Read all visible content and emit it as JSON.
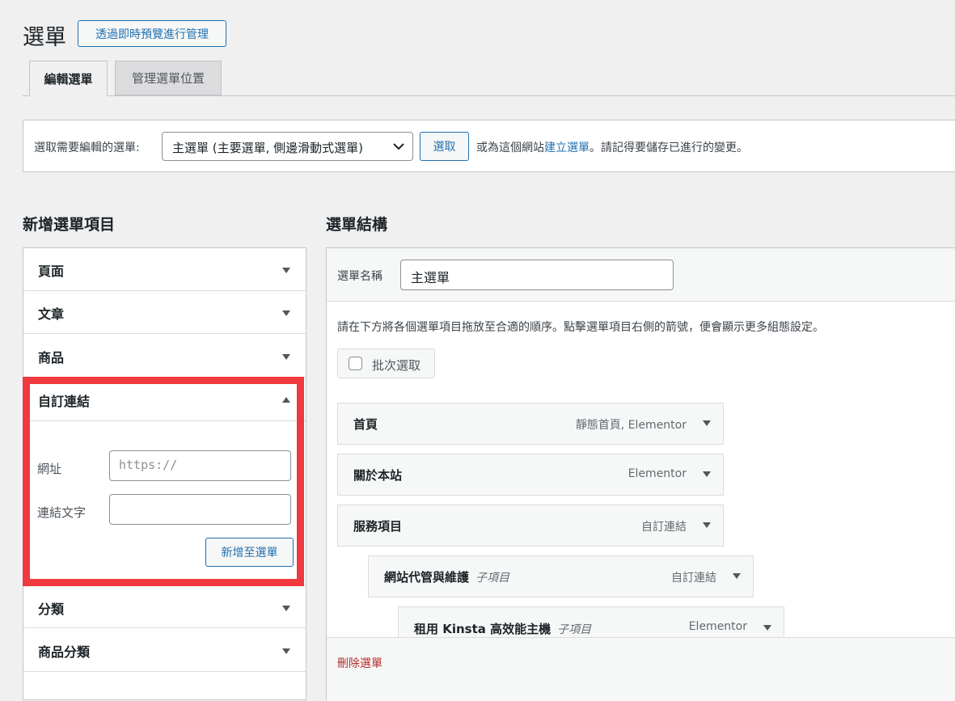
{
  "header": {
    "title": "選單",
    "live_preview_button": "透過即時預覽進行管理"
  },
  "tabs": [
    {
      "label": "編輯選單"
    },
    {
      "label": "管理選單位置"
    }
  ],
  "select_bar": {
    "label": "選取需要編輯的選單:",
    "selected_menu": "主選單 (主要選單, 側邊滑動式選單)",
    "select_button": "選取",
    "text_before_link": "或為這個網站",
    "create_link": "建立選單",
    "text_after_link": "。請記得要儲存已進行的變更。"
  },
  "add_items": {
    "heading": "新增選單項目",
    "sections": [
      {
        "label": "頁面"
      },
      {
        "label": "文章"
      },
      {
        "label": "商品"
      },
      {
        "label": "自訂連結"
      },
      {
        "label": "分類"
      },
      {
        "label": "商品分類"
      }
    ],
    "custom_link": {
      "url_label": "網址",
      "url_placeholder": "https://",
      "link_text_label": "連結文字",
      "link_text_value": "",
      "add_button": "新增至選單"
    }
  },
  "structure": {
    "heading": "選單結構",
    "name_label": "選單名稱",
    "name_value": "主選單",
    "instructions": "請在下方將各個選單項目拖放至合適的順序。點擊選單項目右側的箭號，便會顯示更多組態設定。",
    "bulk_select": "批次選取",
    "items": [
      {
        "title": "首頁",
        "sub": "",
        "type": "靜態首頁, Elementor"
      },
      {
        "title": "關於本站",
        "sub": "",
        "type": "Elementor"
      },
      {
        "title": "服務項目",
        "sub": "",
        "type": "自訂連結"
      },
      {
        "title": "網站代管與維護",
        "sub": "子項目",
        "type": "自訂連結"
      },
      {
        "title": "租用 Kinsta 高效能主機",
        "sub": "子項目",
        "type": "Elementor"
      }
    ],
    "delete_link": "刪除選單"
  },
  "colors": {
    "accent": "#2271b1",
    "highlight_border": "#f0393e",
    "delete": "#b32d2e"
  }
}
